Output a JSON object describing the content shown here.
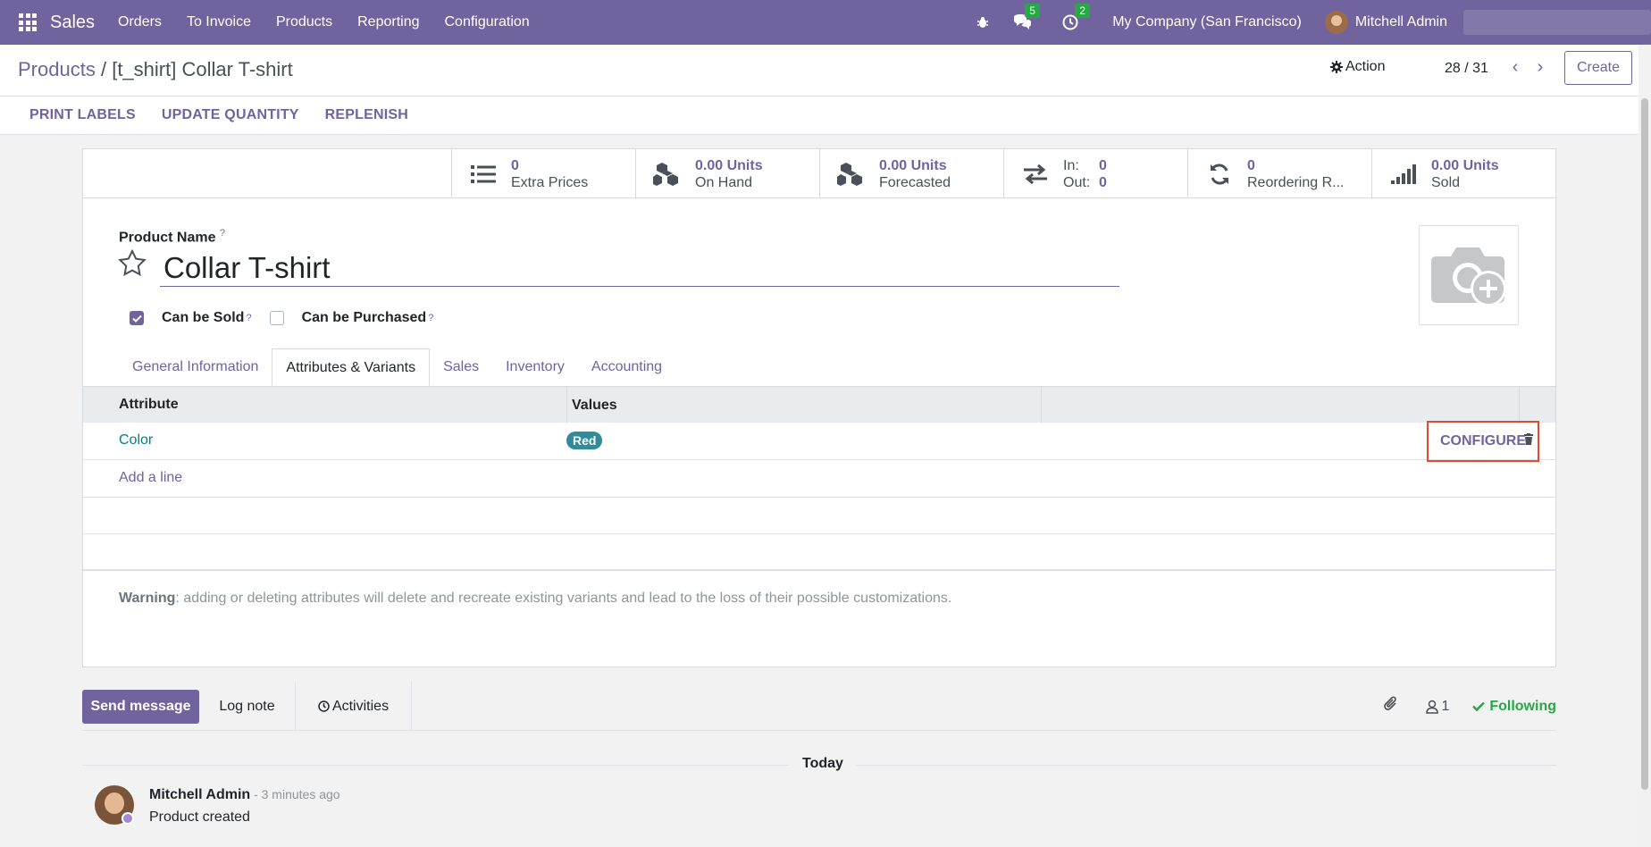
{
  "navbar": {
    "brand": "Sales",
    "menu": [
      "Orders",
      "To Invoice",
      "Products",
      "Reporting",
      "Configuration"
    ],
    "messages_count": "5",
    "activities_count": "2",
    "company": "My Company (San Francisco)",
    "user": "Mitchell Admin"
  },
  "control": {
    "breadcrumb_parent": "Products",
    "breadcrumb_sep": "/",
    "breadcrumb_current": "[t_shirt] Collar T-shirt",
    "action_label": "Action",
    "pager": "28 / 31",
    "create_label": "Create"
  },
  "statusbar": {
    "buttons": [
      "PRINT LABELS",
      "UPDATE QUANTITY",
      "REPLENISH"
    ]
  },
  "smart_buttons": {
    "extra_prices": {
      "value": "0",
      "label": "Extra Prices"
    },
    "on_hand": {
      "value": "0.00 Units",
      "label": "On Hand"
    },
    "forecasted": {
      "value": "0.00 Units",
      "label": "Forecasted"
    },
    "in_out": {
      "in_label": "In:",
      "in_value": "0",
      "out_label": "Out:",
      "out_value": "0"
    },
    "reordering": {
      "value": "0",
      "label": "Reordering R..."
    },
    "sold": {
      "value": "0.00 Units",
      "label": "Sold"
    }
  },
  "form": {
    "product_name_label": "Product Name",
    "help_mark": "?",
    "product_name": "Collar T-shirt",
    "can_be_sold_label": "Can be Sold",
    "can_be_purchased_label": "Can be Purchased",
    "tabs": [
      "General Information",
      "Attributes & Variants",
      "Sales",
      "Inventory",
      "Accounting"
    ],
    "table": {
      "col_attribute": "Attribute",
      "col_values": "Values",
      "rows": [
        {
          "attribute": "Color",
          "value": "Red"
        }
      ],
      "configure_label": "CONFIGURE",
      "add_line": "Add a line"
    },
    "warning_label": "Warning",
    "warning_text": ": adding or deleting attributes will delete and recreate existing variants and lead to the loss of their possible customizations."
  },
  "chatter": {
    "send_message": "Send message",
    "log_note": "Log note",
    "activities": "Activities",
    "followers_count": "1",
    "following_label": "Following",
    "date_separator": "Today",
    "messages": [
      {
        "author": "Mitchell Admin",
        "time": " - 3 minutes ago",
        "body": "Product created"
      }
    ]
  },
  "colors": {
    "brand": "#71639e",
    "highlight": "#e04a2d",
    "tag": "#338a99",
    "success": "#28a745"
  }
}
